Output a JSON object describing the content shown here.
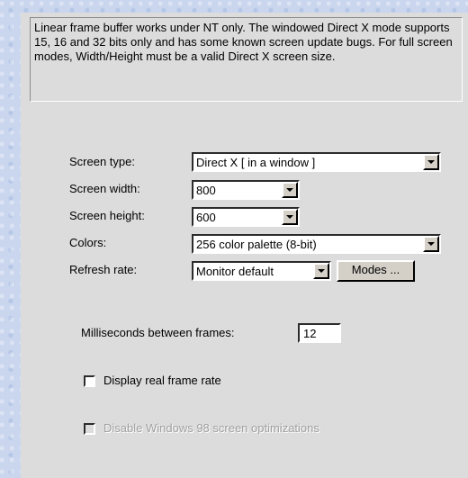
{
  "info_text": "Linear frame buffer works under NT only. The windowed Direct X mode supports 15, 16 and 32 bits only and has some known screen update bugs. For full screen modes, Width/Height must be a valid Direct X screen size.",
  "screen_type": {
    "label": "Screen type:",
    "value": "Direct X [ in a window ]"
  },
  "screen_width": {
    "label": "Screen width:",
    "value": "800"
  },
  "screen_height": {
    "label": "Screen height:",
    "value": "600"
  },
  "colors": {
    "label": "Colors:",
    "value": "256 color palette  (8-bit)"
  },
  "refresh_rate": {
    "label": "Refresh rate:",
    "value": "Monitor default",
    "modes_button": "Modes ..."
  },
  "ms_between_frames": {
    "label": "Milliseconds between frames:",
    "value": "12"
  },
  "display_frame_rate": {
    "label": "Display real frame rate",
    "checked": false
  },
  "disable_win98": {
    "label": "Disable Windows 98 screen optimizations",
    "checked": false,
    "enabled": false
  }
}
